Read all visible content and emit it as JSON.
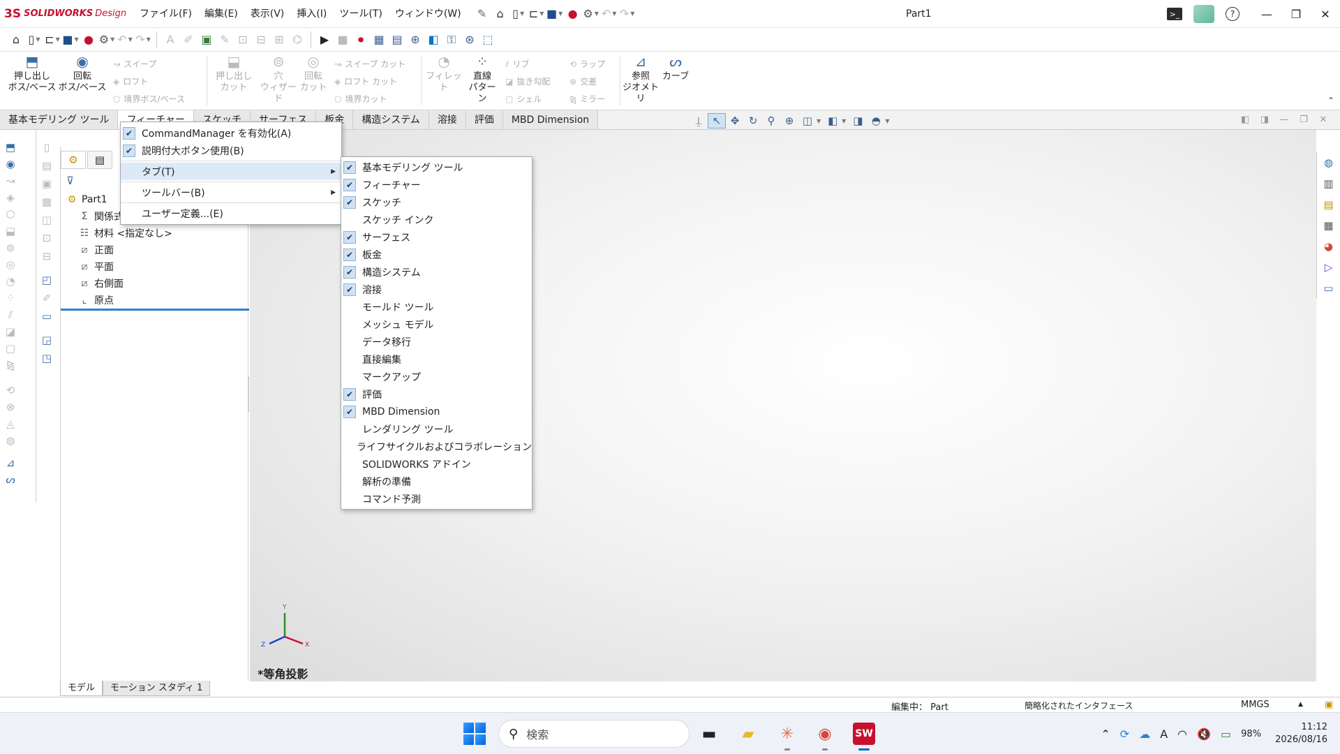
{
  "app": {
    "logo_ds": "3S",
    "logo_brand": "SOLIDWORKS",
    "logo_sub": "Design",
    "doc_title": "Part1"
  },
  "menubar": [
    "ファイル(F)",
    "編集(E)",
    "表示(V)",
    "挿入(I)",
    "ツール(T)",
    "ウィンドウ(W)"
  ],
  "commandmanager": {
    "extrude_boss": "押し出し\nボス/ベース",
    "revolve_boss": "回転\nボス/ベース",
    "sweep": "スイープ",
    "loft": "ロフト",
    "boundary_boss": "境界ボス/ベース",
    "extrude_cut": "押し出し\nカット",
    "hole_wizard": "穴\nウィザード",
    "revolve_cut": "回転\nカット",
    "sweep_cut": "スイープ カット",
    "loft_cut": "ロフト カット",
    "boundary_cut": "境界カット",
    "fillet": "フィレット",
    "linear_pattern": "直線\nパターン",
    "rib": "リブ",
    "draft": "抜き勾配",
    "shell": "シェル",
    "wrap": "ラップ",
    "intersect": "交差",
    "mirror": "ミラー",
    "ref_geometry": "参照\nジオメトリ",
    "curves": "カーブ"
  },
  "tabs": [
    "基本モデリング ツール",
    "フィーチャー",
    "スケッチ",
    "サーフェス",
    "板金",
    "構造システム",
    "溶接",
    "評価",
    "MBD Dimension"
  ],
  "feature_tree": {
    "root": "Part1",
    "items": [
      "関係式",
      "材料 <指定なし>",
      "正面",
      "平面",
      "右側面",
      "原点"
    ]
  },
  "bottom_tabs": [
    "モデル",
    "モーション スタディ 1"
  ],
  "view_label": "*等角投影",
  "context_menu": {
    "items": [
      {
        "label": "CommandManager を有効化(A)",
        "checked": true
      },
      {
        "label": "説明付大ボタン使用(B)",
        "checked": true
      },
      {
        "label": "タブ(T)",
        "checked": false,
        "submenu": true
      },
      {
        "label": "ツールバー(B)",
        "checked": false,
        "submenu": true
      },
      {
        "label": "ユーザー定義...(E)",
        "checked": false
      }
    ]
  },
  "tab_menu": {
    "items": [
      {
        "label": "基本モデリング ツール",
        "checked": true
      },
      {
        "label": "フィーチャー",
        "checked": true
      },
      {
        "label": "スケッチ",
        "checked": true
      },
      {
        "label": "スケッチ インク",
        "checked": false
      },
      {
        "label": "サーフェス",
        "checked": true
      },
      {
        "label": "板金",
        "checked": true
      },
      {
        "label": "構造システム",
        "checked": true
      },
      {
        "label": "溶接",
        "checked": true
      },
      {
        "label": "モールド ツール",
        "checked": false
      },
      {
        "label": "メッシュ モデル",
        "checked": false
      },
      {
        "label": "データ移行",
        "checked": false
      },
      {
        "label": "直接編集",
        "checked": false
      },
      {
        "label": "マークアップ",
        "checked": false
      },
      {
        "label": "評価",
        "checked": true
      },
      {
        "label": "MBD Dimension",
        "checked": true
      },
      {
        "label": "レンダリング ツール",
        "checked": false
      },
      {
        "label": "ライフサイクルおよびコラボレーション",
        "checked": false
      },
      {
        "label": "SOLIDWORKS アドイン",
        "checked": false
      },
      {
        "label": "解析の準備",
        "checked": false
      },
      {
        "label": "コマンド予測",
        "checked": false
      }
    ]
  },
  "statusbar": {
    "editing": "編集中： Part",
    "interface": "簡略化されたインタフェース",
    "units": "MMGS"
  },
  "taskbar": {
    "search_placeholder": "検索",
    "time": "11:12",
    "date": "2026/08/16",
    "battery": "98%",
    "sw_badge": "SW"
  },
  "triad": {
    "x": "X",
    "y": "Y",
    "z": "Z"
  }
}
